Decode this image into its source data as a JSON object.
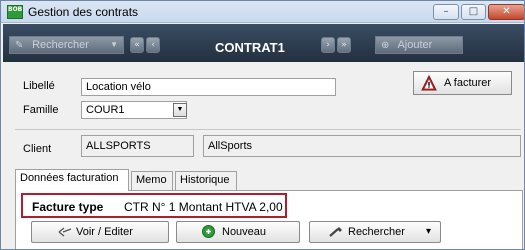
{
  "window": {
    "title": "Gestion des contrats",
    "minimize": "–",
    "maximize": "□",
    "close": "✕",
    "app_icon_text": "BOB"
  },
  "navbar": {
    "search_label": "Rechercher",
    "search_caret": "▼",
    "prev_first": "«",
    "prev": "‹",
    "record_title": "CONTRAT1",
    "next": "›",
    "next_last": "»",
    "add_label": "Ajouter"
  },
  "form": {
    "libelle_label": "Libellé",
    "libelle_value": "Location vélo",
    "famille_label": "Famille",
    "famille_value": "COUR1",
    "afacturer_label": "A facturer",
    "client_label": "Client",
    "client_code": "ALLSPORTS",
    "client_name": "AllSports"
  },
  "tabs": [
    {
      "label": "Données facturation",
      "active": true
    },
    {
      "label": "Memo",
      "active": false
    },
    {
      "label": "Historique",
      "active": false
    }
  ],
  "facture": {
    "type_label": "Facture type",
    "type_value": "CTR N° 1 Montant HTVA 2,00"
  },
  "actions": {
    "view_edit": "Voir / Editer",
    "new": "Nouveau",
    "search": "Rechercher",
    "search_caret": "▾"
  },
  "colors": {
    "highlight_border": "#b01e2e",
    "navbar": "#2c3a4b",
    "warning_red": "#c0282d"
  }
}
